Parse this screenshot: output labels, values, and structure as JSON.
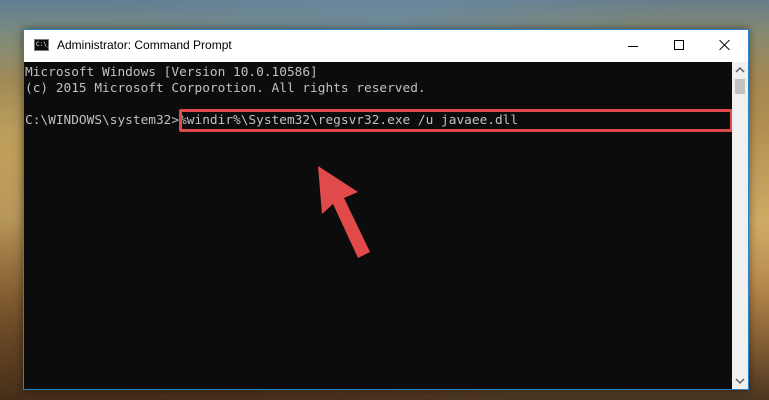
{
  "window": {
    "title": "Administrator: Command Prompt",
    "app_icon_text": "C:\\_"
  },
  "console": {
    "line_1": "Microsoft Windows [Version 10.0.10586]",
    "line_2": "(c) 2015 Microsoft Corporotion. All rights reserved.",
    "prompt": "C:\\WINDOWS\\system32>",
    "command": "%windir%\\System32\\regsvr32.exe /u javaee.dll"
  },
  "colors": {
    "console_bg": "#0c0c0c",
    "console_text": "#c0c0c0",
    "highlight": "#e04a4a"
  },
  "icons": {
    "app": "cmd-icon",
    "minimize": "minimize-icon",
    "maximize": "maximize-icon",
    "close": "close-icon",
    "pointer": "red-arrow-icon"
  }
}
